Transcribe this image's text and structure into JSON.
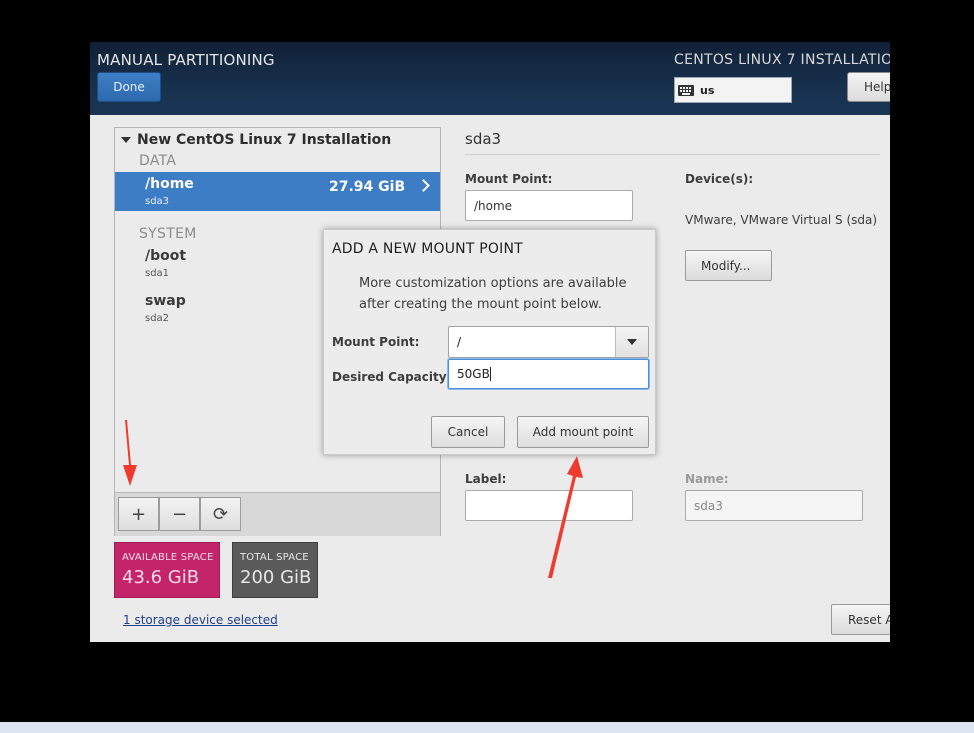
{
  "header": {
    "page_title": "MANUAL PARTITIONING",
    "done_label": "Done",
    "product_title": "CENTOS LINUX 7 INSTALLATIO",
    "keyboard_layout": "us",
    "help_label": "Help"
  },
  "tree": {
    "root_label": "New CentOS Linux 7 Installation",
    "sections": [
      {
        "label": "DATA",
        "items": [
          {
            "name": "/home",
            "device": "sda3",
            "size": "27.94 GiB",
            "selected": true
          }
        ]
      },
      {
        "label": "SYSTEM",
        "items": [
          {
            "name": "/boot",
            "device": "sda1"
          },
          {
            "name": "swap",
            "device": "sda2"
          }
        ]
      }
    ],
    "toolbar": {
      "add": "+",
      "remove": "−",
      "refresh": "⟳"
    }
  },
  "space": {
    "available_label": "AVAILABLE SPACE",
    "available_value": "43.6 GiB",
    "total_label": "TOTAL SPACE",
    "total_value": "200 GiB",
    "storage_link": "1 storage device selected"
  },
  "detail": {
    "title": "sda3",
    "mount_point_label": "Mount Point:",
    "mount_point_value": "/home",
    "devices_label": "Device(s):",
    "devices_value": "VMware, VMware Virtual S (sda)",
    "modify_label": "Modify...",
    "label_label": "Label:",
    "label_value": "",
    "name_label": "Name:",
    "name_value": "sda3",
    "reset_label": "Reset All"
  },
  "dialog": {
    "title": "ADD A NEW MOUNT POINT",
    "description": "More customization options are available after creating the mount point below.",
    "mount_point_label": "Mount Point:",
    "mount_point_value": "/",
    "capacity_label": "Desired Capacity:",
    "capacity_value": "50GB",
    "cancel_label": "Cancel",
    "add_label": "Add mount point"
  },
  "colors": {
    "header_bg": "#17304d",
    "selection": "#3c7dc5",
    "available_space": "#c4246a",
    "total_space": "#5a5a5a",
    "annotation_arrow": "#f03a30"
  }
}
